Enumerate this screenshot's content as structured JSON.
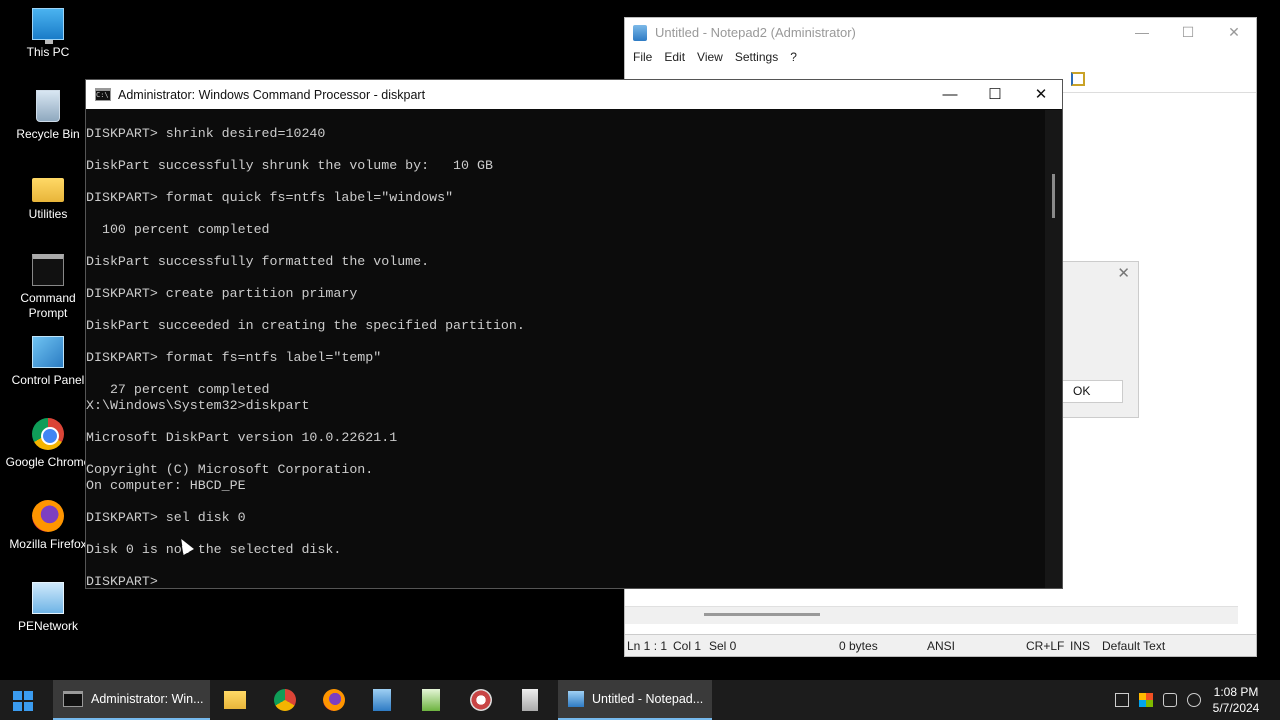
{
  "desktop": {
    "icons": [
      {
        "label": "This PC",
        "icon": "this-pc-icon"
      },
      {
        "label": "Recycle Bin",
        "icon": "recycle-bin-icon"
      },
      {
        "label": "Utilities",
        "icon": "folder-icon"
      },
      {
        "label": "Command Prompt",
        "icon": "command-prompt-icon"
      },
      {
        "label": "Control Panel",
        "icon": "control-panel-icon"
      },
      {
        "label": "Google Chrome",
        "icon": "chrome-icon"
      },
      {
        "label": "Mozilla Firefox",
        "icon": "firefox-icon"
      },
      {
        "label": "PENetwork",
        "icon": "network-icon"
      }
    ]
  },
  "notepad": {
    "title": "Untitled - Notepad2 (Administrator)",
    "menu": [
      "File",
      "Edit",
      "View",
      "Settings",
      "?"
    ],
    "status": {
      "position": "Ln 1 : 1",
      "col": "Col 1",
      "sel": "Sel 0",
      "size": "0 bytes",
      "encoding": "ANSI",
      "line_endings": "CR+LF",
      "mode": "INS",
      "scheme": "Default Text"
    }
  },
  "dialog": {
    "ok_label": "OK",
    "close_glyph": "✕"
  },
  "cmd": {
    "title": "Administrator: Windows Command Processor - diskpart",
    "icon_text": "C:\\",
    "lines": [
      "DISKPART> shrink desired=10240",
      "",
      "DiskPart successfully shrunk the volume by:   10 GB",
      "",
      "DISKPART> format quick fs=ntfs label=\"windows\"",
      "",
      "  100 percent completed",
      "",
      "DiskPart successfully formatted the volume.",
      "",
      "DISKPART> create partition primary",
      "",
      "DiskPart succeeded in creating the specified partition.",
      "",
      "DISKPART> format fs=ntfs label=\"temp\"",
      "",
      "   27 percent completed",
      "X:\\Windows\\System32>diskpart",
      "",
      "Microsoft DiskPart version 10.0.22621.1",
      "",
      "Copyright (C) Microsoft Corporation.",
      "On computer: HBCD_PE",
      "",
      "DISKPART> sel disk 0",
      "",
      "Disk 0 is now the selected disk.",
      "",
      "DISKPART> "
    ]
  },
  "window_controls": {
    "minimize": "—",
    "maximize": "☐",
    "close": "✕"
  },
  "taskbar": {
    "cmd_task_label": "Administrator: Win...",
    "notepad_task_label": "Untitled - Notepad...",
    "time": "1:08 PM",
    "date": "5/7/2024",
    "colors": {
      "accent": "#76b9ed",
      "background": "#1c1c1c"
    }
  }
}
